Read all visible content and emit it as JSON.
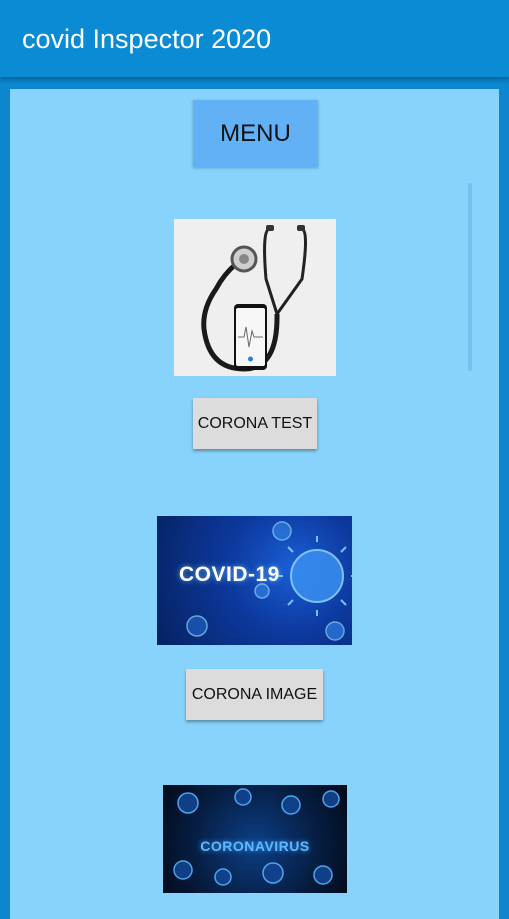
{
  "app_bar": {
    "title": "covid Inspector 2020"
  },
  "menu": {
    "label": "MENU"
  },
  "sections": {
    "test": {
      "button_label": "CORONA TEST",
      "image_icon": "stethoscope-phone-image"
    },
    "image": {
      "button_label": "CORONA IMAGE",
      "image_text": "COVID-19",
      "image_icon": "covid-virus-image"
    },
    "virus": {
      "image_text": "CORONAVIRUS",
      "image_icon": "coronavirus-image"
    }
  },
  "colors": {
    "app_bar": "#0a8bd3",
    "content_background": "#87d3fb",
    "menu_button": "#62b1f5",
    "secondary_button": "#dcdcdc"
  }
}
